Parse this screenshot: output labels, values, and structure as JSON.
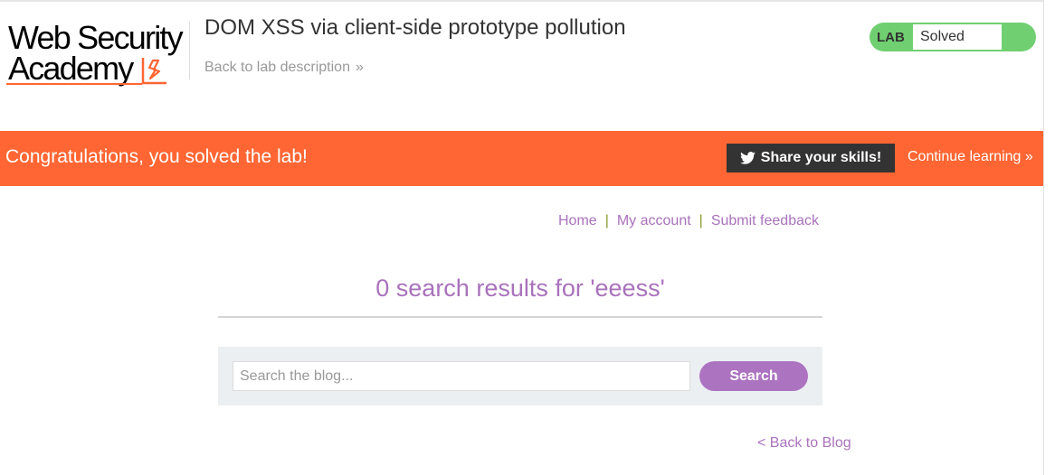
{
  "header": {
    "logo_line1": "Web Security",
    "logo_line2": "Academy",
    "lab_title": "DOM XSS via client-side prototype pollution",
    "back_to_description": "Back to lab description",
    "back_chevron": "»"
  },
  "status": {
    "badge": "LAB",
    "value": "Solved",
    "color": "#70d071"
  },
  "banner": {
    "message": "Congratulations, you solved the lab!",
    "share_label": "Share your skills!",
    "share_icon": "twitter-icon",
    "continue_label": "Continue learning",
    "continue_chevron": "»",
    "color": "#ff6633"
  },
  "nav": {
    "home": "Home",
    "my_account": "My account",
    "submit_feedback": "Submit feedback",
    "separator": "|"
  },
  "results": {
    "heading": "0 search results for 'eeess'"
  },
  "search": {
    "placeholder": "Search the blog...",
    "value": "",
    "button_label": "Search"
  },
  "footer": {
    "back_to_blog": "< Back to Blog"
  },
  "colors": {
    "accent": "#a972bc",
    "brand": "#ff6633"
  }
}
